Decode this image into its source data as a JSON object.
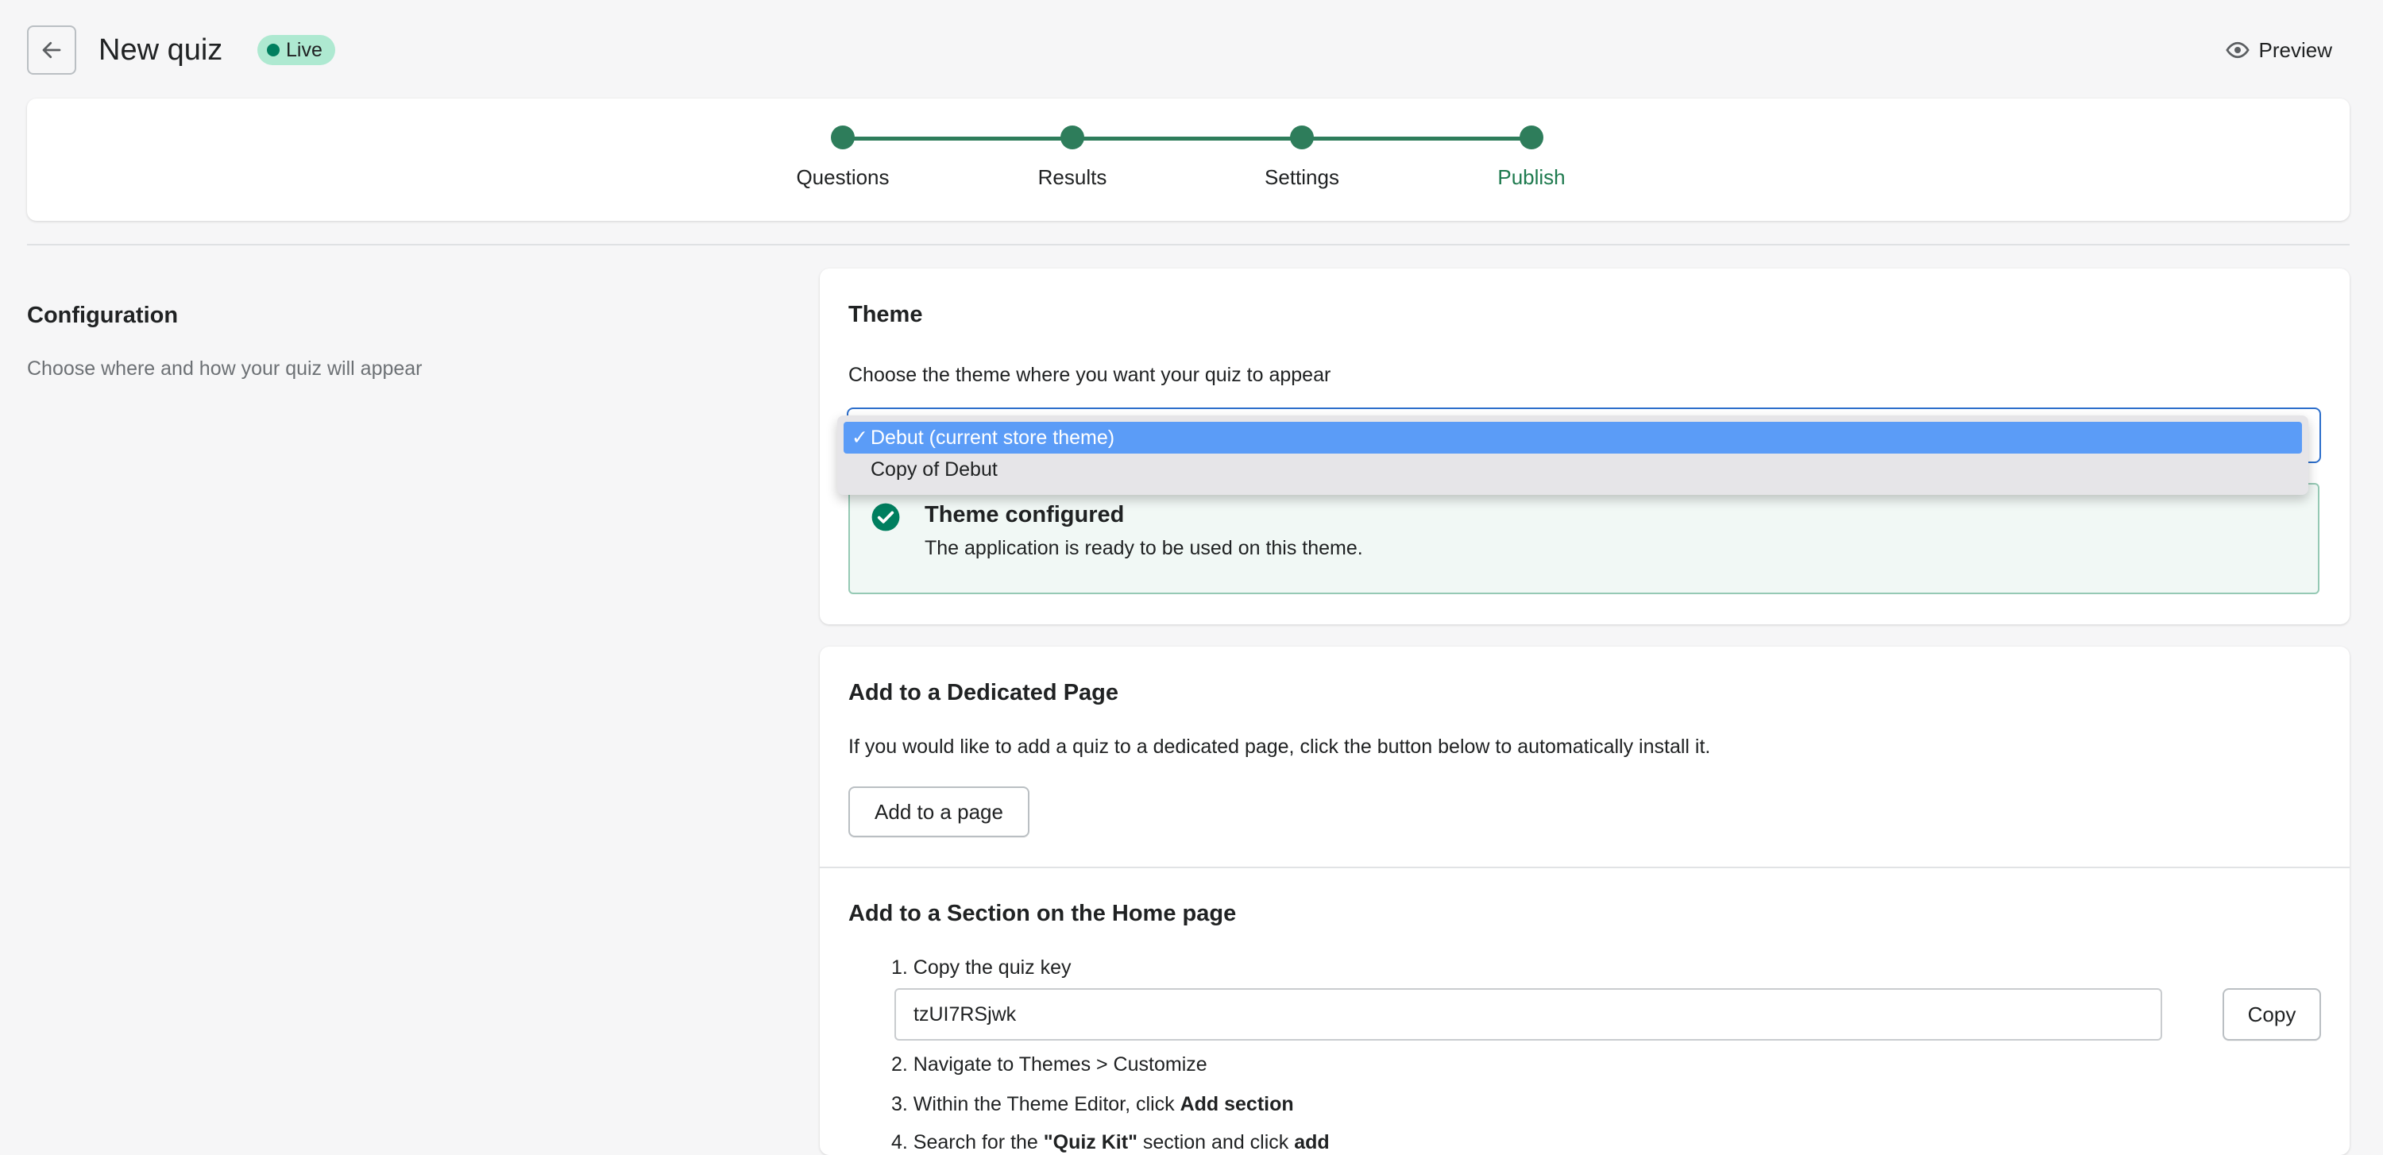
{
  "header": {
    "title": "New quiz",
    "badge": "Live",
    "preview_label": "Preview"
  },
  "stepper": {
    "steps": [
      {
        "label": "Questions"
      },
      {
        "label": "Results"
      },
      {
        "label": "Settings"
      },
      {
        "label": "Publish"
      }
    ],
    "active_index": 3
  },
  "configuration": {
    "title": "Configuration",
    "description": "Choose where and how your quiz will appear"
  },
  "theme_card": {
    "title": "Theme",
    "description": "Choose the theme where you want your quiz to appear",
    "select_value": "Debut (current store theme)",
    "options": [
      "Debut (current store theme)",
      "Copy of Debut"
    ],
    "banner_title": "Theme configured",
    "banner_text": "The application is ready to be used on this theme."
  },
  "dedicated_page": {
    "title": "Add to a Dedicated Page",
    "description": "If you would like to add a quiz to a dedicated page, click the button below to automatically install it.",
    "button_label": "Add to a page"
  },
  "home_section": {
    "title": "Add to a Section on the Home page",
    "step1": "Copy the quiz key",
    "quiz_key": "tzUI7RSjwk",
    "copy_label": "Copy",
    "step2": "Navigate to Themes > Customize",
    "step3_prefix": "Within the Theme Editor, click ",
    "step3_bold": "Add section",
    "step4_prefix": "Search for the ",
    "step4_bold": "\"Quiz Kit\"",
    "step4_mid": " section and click ",
    "step4_end": "add"
  },
  "colors": {
    "accent_green": "#2e7d5b",
    "focus_blue": "#2c6ecb",
    "selected_option": "#5b9cf7",
    "banner_bg": "#f1f8f5"
  }
}
